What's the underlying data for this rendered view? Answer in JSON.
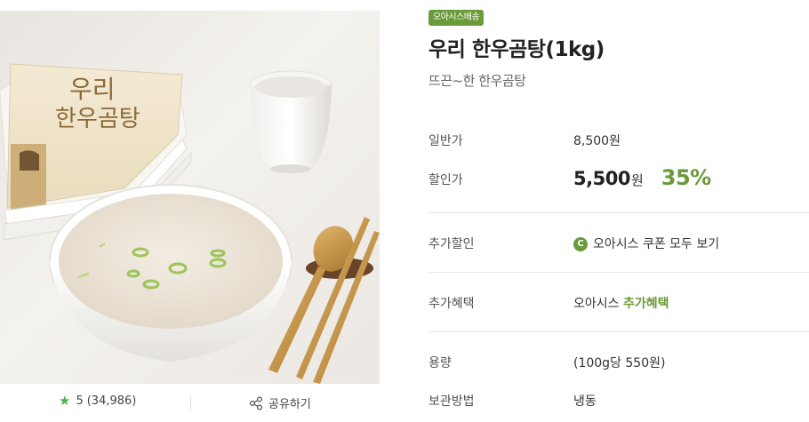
{
  "product": {
    "badge": "오아시스배송",
    "title": "우리 한우곰탕(1kg)",
    "subtitle": "뜨끈~한 한우곰탕",
    "package_text_line1": "우리",
    "package_text_line2": "한우곰탕"
  },
  "review": {
    "icon": "star-icon",
    "rating": "5",
    "count": "(34,986)"
  },
  "share": {
    "icon": "share-icon",
    "label": "공유하기"
  },
  "details": {
    "regular_price_label": "일반가",
    "regular_price": "8,500원",
    "sale_price_label": "할인가",
    "sale_price": "5,500",
    "sale_unit": "원",
    "discount": "35%",
    "extra_discount_label": "추가할인",
    "coupon_icon_text": "C",
    "coupon_link": "오아시스 쿠폰 모두 보기",
    "extra_benefit_label": "추가혜택",
    "extra_benefit_prefix": "오아시스 ",
    "extra_benefit_link": "추가혜택",
    "volume_label": "용량",
    "volume": "(100g당 550원)",
    "storage_label": "보관방법",
    "storage": "냉동"
  },
  "colors": {
    "accent": "#6a9a3a",
    "rating_star": "#4caf50"
  }
}
